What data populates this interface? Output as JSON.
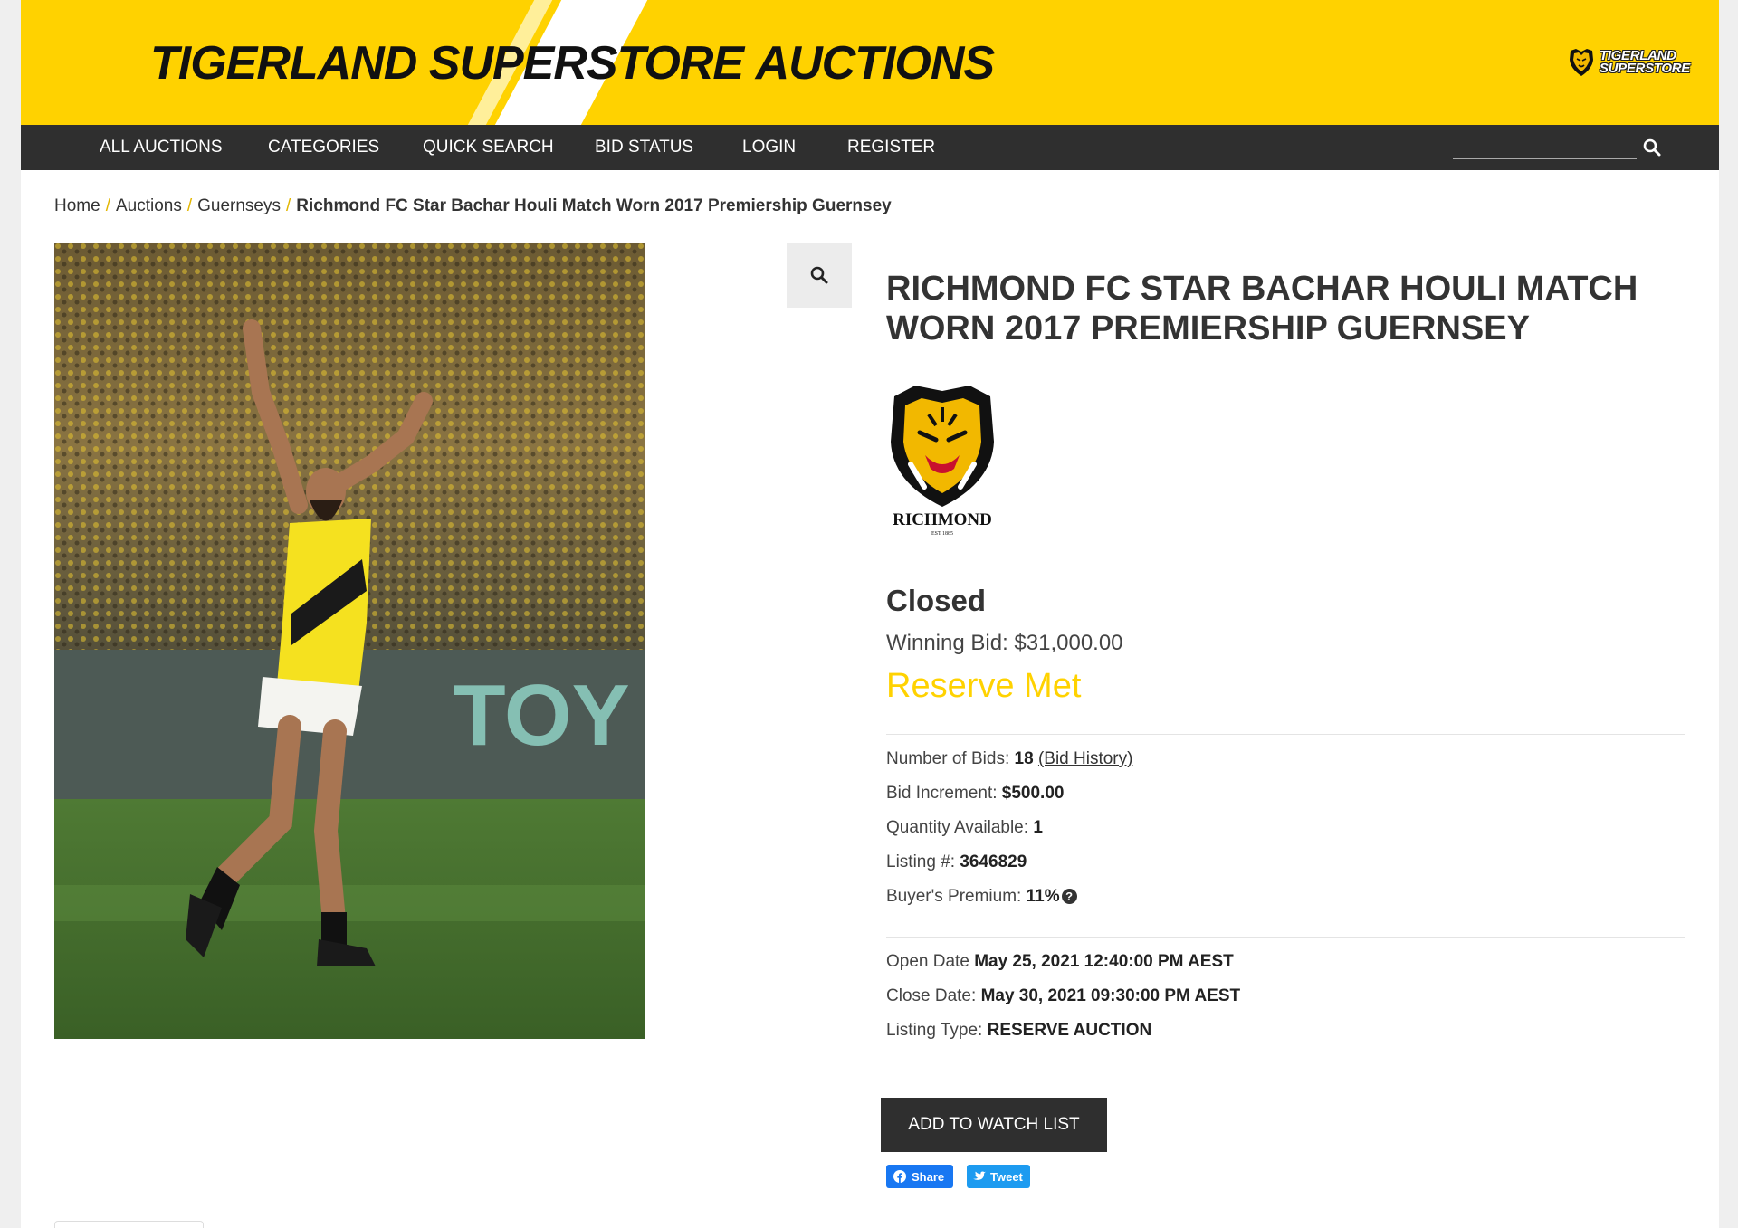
{
  "header": {
    "title_part1": "TIGERLAND SUPERSTORE ",
    "title_part2": "AUCTIONS",
    "logo_line1": "TIGERLAND",
    "logo_line2": "SUPERSTORE",
    "brand_color": "#FFD200"
  },
  "nav": {
    "items": [
      {
        "label": "ALL AUCTIONS"
      },
      {
        "label": "CATEGORIES"
      },
      {
        "label": "QUICK SEARCH"
      },
      {
        "label": "BID STATUS"
      },
      {
        "label": "LOGIN"
      },
      {
        "label": "REGISTER"
      }
    ],
    "search_placeholder": "",
    "search_icon": "search-icon",
    "bar_color": "#2f2f2f"
  },
  "breadcrumb": {
    "items": [
      "Home",
      "Auctions",
      "Guernseys"
    ],
    "separator": "/",
    "current": "Richmond FC Star Bachar Houli Match Worn 2017 Premiership Guernsey"
  },
  "listing": {
    "title": "RICHMOND FC STAR BACHAR HOULI MATCH WORN 2017 PREMIERSHIP GUERNSEY",
    "club_logo_text": "RICHMOND",
    "club_logo_est": "EST 1885",
    "status": "Closed",
    "winning_bid_label": "Winning Bid:",
    "winning_bid_value": "$31,000.00",
    "reserve_text": "Reserve Met",
    "bids_label": "Number of Bids:",
    "bids_value": "18",
    "bid_history_link": "(Bid History)",
    "increment_label": "Bid Increment:",
    "increment_value": "$500.00",
    "quantity_label": "Quantity Available:",
    "quantity_value": "1",
    "listing_no_label": "Listing #:",
    "listing_no_value": "3646829",
    "premium_label": "Buyer's Premium:",
    "premium_value": "11%",
    "open_label": "Open Date",
    "open_value": "May 25, 2021 12:40:00 PM AEST",
    "close_label": "Close Date:",
    "close_value": "May 30, 2021 09:30:00 PM AEST",
    "type_label": "Listing Type:",
    "type_value": "RESERVE AUCTION"
  },
  "actions": {
    "watch_label": "ADD TO WATCH LIST",
    "share_label": "Share",
    "tweet_label": "Tweet"
  }
}
